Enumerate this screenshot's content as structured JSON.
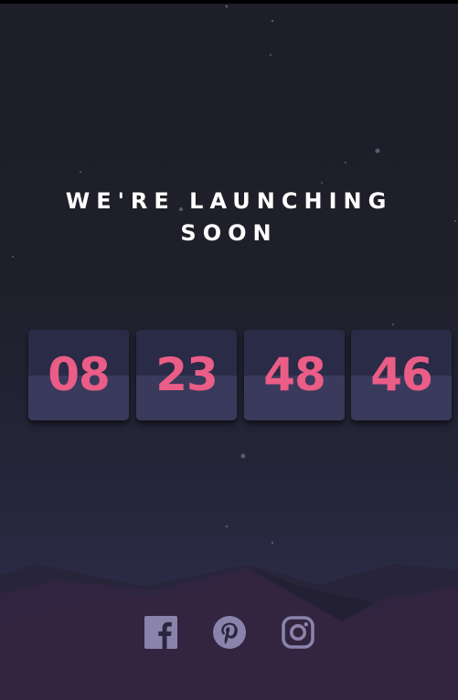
{
  "headline": {
    "line1": "WE'RE LAUNCHING",
    "line2": "SOON"
  },
  "countdown": [
    {
      "value": "08"
    },
    {
      "value": "23"
    },
    {
      "value": "48"
    },
    {
      "value": "46"
    }
  ],
  "social": [
    {
      "icon": "facebook-icon"
    },
    {
      "icon": "pinterest-icon"
    },
    {
      "icon": "instagram-icon"
    }
  ],
  "colors": {
    "digit": "#ea5d86",
    "icon": "#8a84ac",
    "headline": "#ffffff"
  }
}
